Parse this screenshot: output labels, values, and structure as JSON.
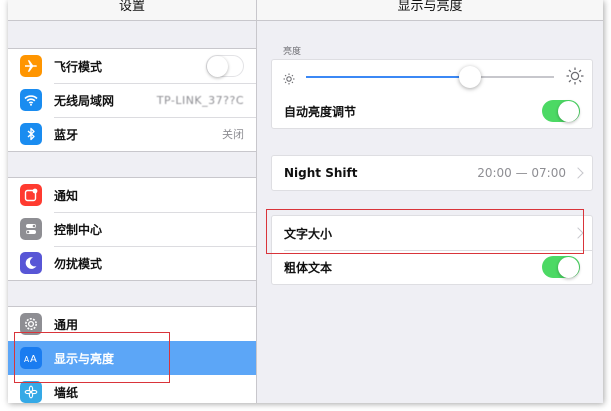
{
  "left": {
    "title": "设置",
    "groups": [
      [
        {
          "label": "飞行模式",
          "icon": "airplane-icon",
          "icon_bg": "#ff9500",
          "accessory": "toggle-off"
        },
        {
          "label": "无线局域网",
          "icon": "wifi-icon",
          "icon_bg": "#1a8cf0",
          "value": "TP-LINK_37??C"
        },
        {
          "label": "蓝牙",
          "icon": "bluetooth-icon",
          "icon_bg": "#1a8cf0",
          "value": "关闭"
        }
      ],
      [
        {
          "label": "通知",
          "icon": "notifications-icon",
          "icon_bg": "#ff3b30"
        },
        {
          "label": "控制中心",
          "icon": "control-center-icon",
          "icon_bg": "#8e8e93"
        },
        {
          "label": "勿扰模式",
          "icon": "moon-icon",
          "icon_bg": "#5856d6"
        }
      ],
      [
        {
          "label": "通用",
          "icon": "gear-icon",
          "icon_bg": "#8e8e93"
        },
        {
          "label": "显示与亮度",
          "icon": "display-brightness-icon",
          "icon_bg": "#1a7cf0",
          "selected": true
        },
        {
          "label": "墙纸",
          "icon": "wallpaper-icon",
          "icon_bg": "#35a9e6"
        }
      ]
    ]
  },
  "right": {
    "title": "显示与亮度",
    "brightness": {
      "section_label": "亮度",
      "level": 0.66,
      "auto_label": "自动亮度调节",
      "auto_on": true
    },
    "night_shift": {
      "label": "Night Shift",
      "value": "20:00 — 07:00"
    },
    "text_size": {
      "label": "文字大小"
    },
    "bold_text": {
      "label": "粗体文本",
      "on": true
    }
  },
  "colors": {
    "accent_blue": "#5ca6f7",
    "toggle_green": "#4cd964",
    "annotation_red": "#d9343a"
  }
}
